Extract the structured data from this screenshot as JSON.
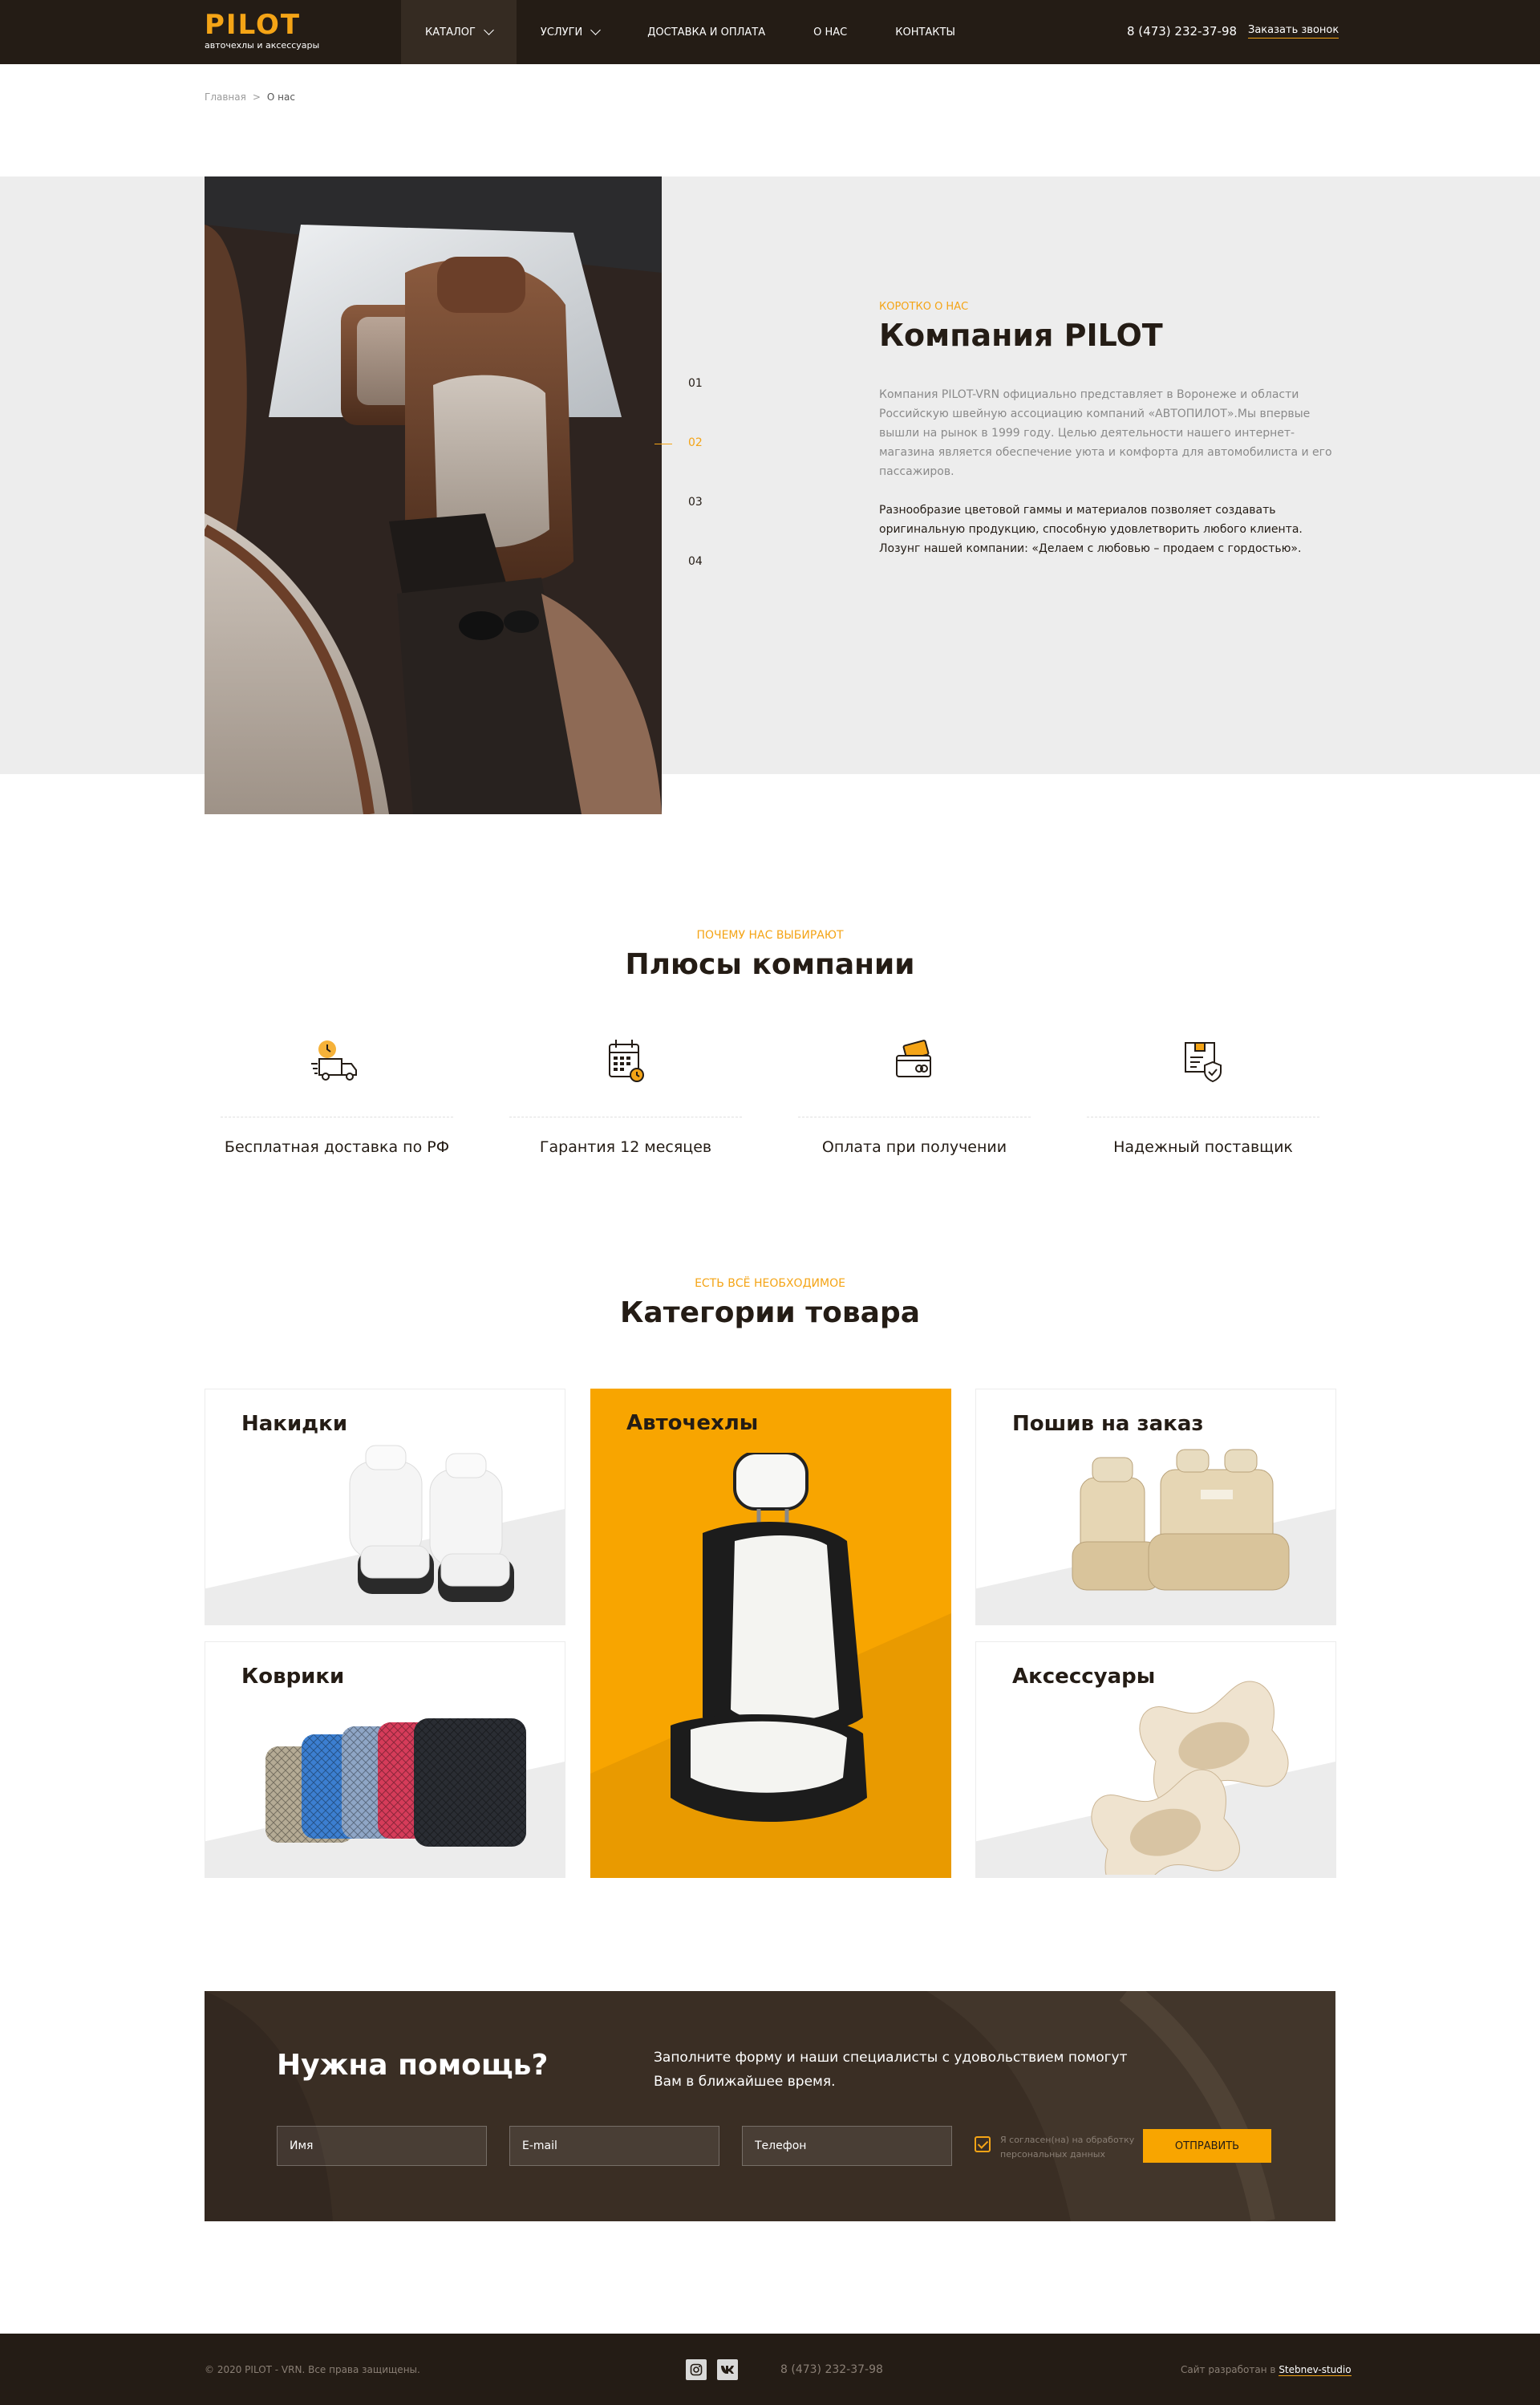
{
  "header": {
    "logo": "PILOT",
    "logo_sub": "авточехлы и аксессуары",
    "nav": [
      {
        "label": "КАТАЛОГ"
      },
      {
        "label": "УСЛУГИ"
      },
      {
        "label": "ДОСТАВКА И ОПЛАТА"
      },
      {
        "label": "О НАС"
      },
      {
        "label": "КОНТАКТЫ"
      }
    ],
    "phone": "8 (473) 232-37-98",
    "callback": "Заказать звонок"
  },
  "breadcrumb": {
    "home": "Главная",
    "separator": ">",
    "current": "О нас"
  },
  "about": {
    "slides": [
      "01",
      "02",
      "03",
      "04"
    ],
    "active_slide": "02",
    "eyebrow": "КОРОТКО О НАС",
    "title": "Компания PILOT",
    "p1": "Компания PILOT-VRN официально представляет в Воронеже и области Российскую швейную ассоциацию компаний «АВТОПИЛОТ».Мы впервые вышли на рынок в 1999 году. Целью деятельности нашего интернет-магазина является обеспечение уюта и комфорта для автомобилиста и его пассажиров.",
    "p2": "Разнообразие цветовой гаммы и материалов позволяет создавать оригинальную продукцию, способную удовлетворить любого клиента. Лозунг нашей компании: «Делаем с любовью – продаем с гордостью»."
  },
  "features": {
    "eyebrow": "ПОЧЕМУ НАС ВЫБИРАЮТ",
    "title": "Плюсы компании",
    "items": [
      {
        "label": "Бесплатная доставка по РФ",
        "icon": "delivery-truck-icon"
      },
      {
        "label": "Гарантия 12 месяцев",
        "icon": "calendar-icon"
      },
      {
        "label": "Оплата при получении",
        "icon": "payment-card-icon"
      },
      {
        "label": "Надежный поставщик",
        "icon": "verified-box-icon"
      }
    ]
  },
  "categories": {
    "eyebrow": "ЕСТЬ ВСЁ НЕОБХОДИМОЕ",
    "title": "Категории товара",
    "items": [
      {
        "label": "Накидки"
      },
      {
        "label": "Авточехлы"
      },
      {
        "label": "Пошив на заказ"
      },
      {
        "label": "Коврики"
      },
      {
        "label": "Аксессуары"
      }
    ]
  },
  "help": {
    "title": "Нужна помощь?",
    "desc": "Заполните форму и наши специалисты с удовольствием помогут Вам в ближайшее время.",
    "name_placeholder": "Имя",
    "email_placeholder": "E-mail",
    "phone_placeholder": "Телефон",
    "consent": "Я согласен(на) на обработку персональных данных",
    "submit": "ОТПРАВИТЬ"
  },
  "footer": {
    "copy": "© 2020 PILOT - VRN. Все права защищены.",
    "phone": "8 (473) 232-37-98",
    "dev_prefix": "Сайт разработан в",
    "dev_link": "Stebnev-studio"
  },
  "colors": {
    "accent": "#f4a416",
    "dark": "#241c15",
    "featured": "#f8a500"
  }
}
